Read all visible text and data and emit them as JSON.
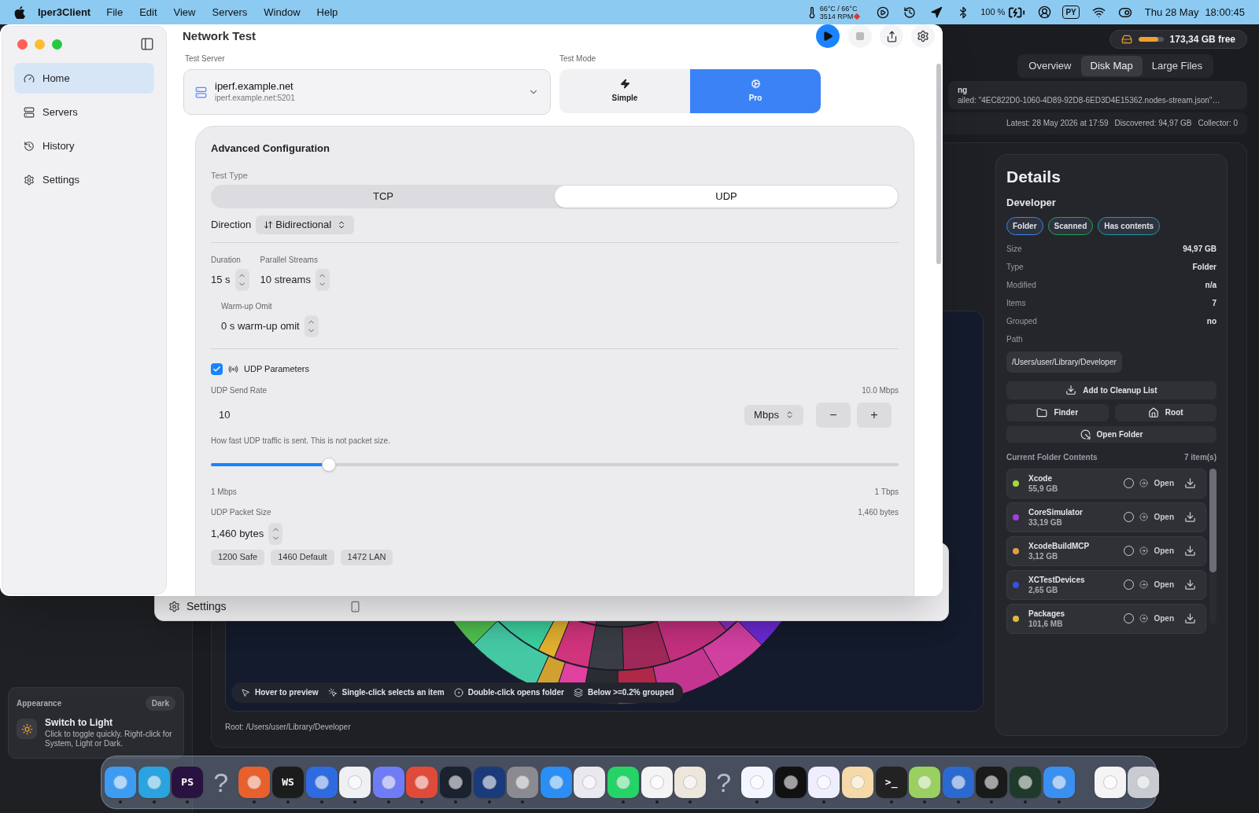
{
  "menu_bar": {
    "app": "Iper3Client",
    "menus": [
      "File",
      "Edit",
      "View",
      "Servers",
      "Window",
      "Help"
    ],
    "temperature": "66°C / 66°C",
    "fan": "3514 RPM",
    "battery": "100 %",
    "badge": "PY",
    "date": "Thu 28 May",
    "time": "18:00:45"
  },
  "network_window": {
    "title": "Network Test",
    "sidebar": [
      {
        "label": "Home",
        "selected": true
      },
      {
        "label": "Servers",
        "selected": false
      },
      {
        "label": "History",
        "selected": false
      },
      {
        "label": "Settings",
        "selected": false
      }
    ],
    "test_server": {
      "label": "Test Server",
      "name": "iperf.example.net",
      "address": "iperf.example.net:5201"
    },
    "test_mode": {
      "label": "Test Mode",
      "options": [
        {
          "label": "Simple",
          "selected": false
        },
        {
          "label": "Pro",
          "selected": true
        }
      ]
    },
    "advanced": {
      "title": "Advanced Configuration",
      "test_type": {
        "label": "Test Type",
        "options": [
          {
            "label": "TCP",
            "selected": false
          },
          {
            "label": "UDP",
            "selected": true
          }
        ]
      },
      "direction": {
        "label": "Direction",
        "value": "Bidirectional"
      },
      "duration": {
        "label": "Duration",
        "value": "15 s"
      },
      "streams": {
        "label": "Parallel Streams",
        "value": "10 streams"
      },
      "warmup": {
        "label": "Warm-up Omit",
        "value": "0 s warm-up omit"
      },
      "udp": {
        "label": "UDP Parameters",
        "checked": true,
        "send_rate": {
          "label": "UDP Send Rate",
          "reading": "10.0 Mbps",
          "value": "10",
          "unit": "Mbps",
          "minus": "−",
          "plus": "+",
          "help": "How fast UDP traffic is sent. This is not packet size.",
          "level": 0.172,
          "min": "1 Mbps",
          "max": "1 Tbps"
        },
        "packet_size": {
          "label": "UDP Packet Size",
          "reading": "1,460 bytes",
          "value": "1,460 bytes",
          "presets": [
            "1200 Safe",
            "1460 Default",
            "1472 LAN"
          ]
        }
      }
    }
  },
  "settings_window": {
    "title": "Settings"
  },
  "disk_window": {
    "free": "173,34 GB free",
    "level": 0.8,
    "tabs": [
      {
        "label": "Overview",
        "selected": false
      },
      {
        "label": "Disk Map",
        "selected": true
      },
      {
        "label": "Large Files",
        "selected": false
      }
    ],
    "notice": {
      "title": "ng",
      "message": "ailed: \"4EC822D0-1060-4D89-92D8-6ED3D4E15362.nodes-stream.json\"…"
    },
    "status": [
      "Latest: 28 May 2026 at 17:59",
      "Discovered: 94,97 GB",
      "Collector: 0"
    ],
    "hints": [
      "Hover to preview",
      "Single-click selects an item",
      "Double-click opens folder",
      "Below >=0.2% grouped"
    ],
    "root": "Root: /Users/user/Library/Developer",
    "details": {
      "title": "Details",
      "name": "Developer",
      "tags": [
        {
          "label": "Folder",
          "color": "#3b82f6"
        },
        {
          "label": "Scanned",
          "color": "#22a34a"
        },
        {
          "label": "Has contents",
          "color": "#1f9aa8"
        }
      ],
      "rows": [
        {
          "label": "Size",
          "value": "94,97 GB"
        },
        {
          "label": "Type",
          "value": "Folder"
        },
        {
          "label": "Modified",
          "value": "n/a"
        },
        {
          "label": "Items",
          "value": "7"
        },
        {
          "label": "Grouped",
          "value": "no"
        }
      ],
      "path_label": "Path",
      "path": "/Users/user/Library/Developer",
      "actions": {
        "cleanup": "Add to Cleanup List",
        "finder": "Finder",
        "root": "Root",
        "open_folder": "Open Folder"
      },
      "contents": {
        "title": "Current Folder Contents",
        "count": "7 item(s)",
        "items": [
          {
            "name": "Xcode",
            "size": "55,9 GB",
            "color": "#a3d93a",
            "selected": false,
            "action": "Open"
          },
          {
            "name": "CoreSimulator",
            "size": "33,19 GB",
            "color": "#a23ee0",
            "selected": false,
            "action": "Open"
          },
          {
            "name": "XcodeBuildMCP",
            "size": "3,12 GB",
            "color": "#e0a040",
            "selected": false,
            "action": "Open"
          },
          {
            "name": "XCTestDevices",
            "size": "2,65 GB",
            "color": "#3b4fe0",
            "selected": false,
            "action": "Open"
          },
          {
            "name": "Packages",
            "size": "101,6 MB",
            "color": "#e0b840",
            "selected": false,
            "action": "Open"
          }
        ]
      }
    },
    "appearance": {
      "title": "Appearance",
      "mode": "Dark",
      "heading": "Switch to Light",
      "text": "Click to toggle quickly. Right-click for System, Light or Dark."
    }
  },
  "dock": {
    "apps": [
      {
        "kind": "app",
        "color": "#3d9cf2",
        "running": true
      },
      {
        "kind": "app",
        "color": "#2aa3e0",
        "running": true
      },
      {
        "kind": "app",
        "color": "#2a1240",
        "label": "PS",
        "running": true
      },
      {
        "kind": "placeholder",
        "glyph": "?",
        "running": false
      },
      {
        "kind": "app",
        "color": "#e8602c",
        "running": true
      },
      {
        "kind": "app",
        "color": "#1c1c1c",
        "label": "WS",
        "running": true
      },
      {
        "kind": "app",
        "color": "#2f6be0",
        "running": true
      },
      {
        "kind": "app",
        "color": "#eef0f4",
        "running": true
      },
      {
        "kind": "app",
        "color": "#6f7cf5",
        "running": true
      },
      {
        "kind": "app",
        "color": "#e04a3a",
        "running": true
      },
      {
        "kind": "app",
        "color": "#1a2230",
        "running": true
      },
      {
        "kind": "app",
        "color": "#1a3a7a",
        "running": true
      },
      {
        "kind": "app",
        "color": "#8a8a90",
        "running": true
      },
      {
        "kind": "app",
        "color": "#2a8ef5",
        "running": false
      },
      {
        "kind": "app",
        "color": "#e8e8ee",
        "running": false
      },
      {
        "kind": "app",
        "color": "#25d366",
        "running": true
      },
      {
        "kind": "app",
        "color": "#f4f4f4",
        "running": true
      },
      {
        "kind": "app",
        "color": "#ece6dc",
        "running": true
      },
      {
        "kind": "placeholder",
        "glyph": "?",
        "running": false
      },
      {
        "kind": "app",
        "color": "#f4f6ff",
        "running": true
      },
      {
        "kind": "app",
        "color": "#111111",
        "running": false
      },
      {
        "kind": "app",
        "color": "#eeeeff",
        "running": true
      },
      {
        "kind": "app",
        "color": "#f5d9a8",
        "running": false
      },
      {
        "kind": "app",
        "color": "#222222",
        "label": ">_",
        "running": true
      },
      {
        "kind": "app",
        "color": "#9ad060",
        "running": true
      },
      {
        "kind": "app",
        "color": "#2a6ad0",
        "running": true
      },
      {
        "kind": "app",
        "color": "#1a1a1a",
        "running": true
      },
      {
        "kind": "app",
        "color": "#1f3a2a",
        "running": true
      },
      {
        "kind": "app",
        "color": "#3a90f0",
        "running": true
      }
    ],
    "others": [
      {
        "kind": "app",
        "color": "#f4f4f4",
        "running": false
      },
      {
        "kind": "app",
        "color": "#c8ccd2",
        "running": false
      }
    ]
  }
}
